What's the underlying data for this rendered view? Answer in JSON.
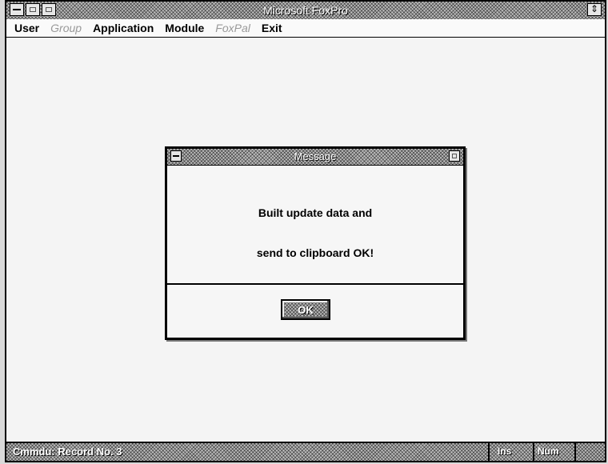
{
  "window": {
    "title": "Microsoft FoxPro"
  },
  "menu": {
    "items": [
      {
        "label": "User",
        "enabled": true
      },
      {
        "label": "Group",
        "enabled": false
      },
      {
        "label": "Application",
        "enabled": true
      },
      {
        "label": "Module",
        "enabled": true
      },
      {
        "label": "FoxPal",
        "enabled": false
      },
      {
        "label": "Exit",
        "enabled": true
      }
    ]
  },
  "dialog": {
    "title": "Message",
    "line1": "Built update data and",
    "line2": "send to clipboard OK!",
    "ok_label": "OK"
  },
  "status": {
    "text": "Cmmdu: Record No. 3",
    "ins": "Ins",
    "num": "Num"
  },
  "icons": {
    "system_menu": "system-menu-icon",
    "minimize": "minimize-icon",
    "maximize": "maximize-icon",
    "restore": "restore-icon"
  }
}
